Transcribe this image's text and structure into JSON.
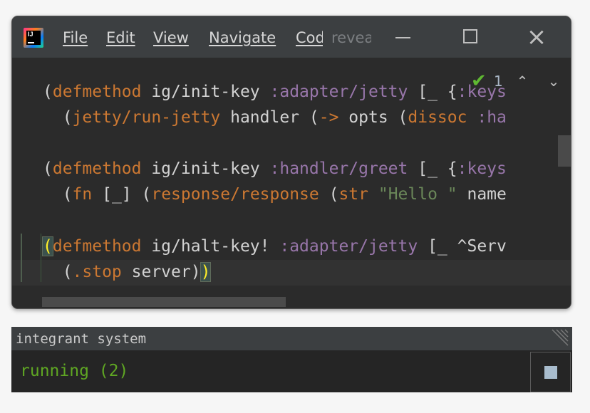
{
  "menu": {
    "file": "File",
    "edit": "Edit",
    "view": "View",
    "navigate": "Navigate",
    "code": "Code",
    "search_hint": "reveal"
  },
  "app_logo_text": "IJ",
  "window_controls": [
    "minimize-icon",
    "maximize-icon",
    "close-icon"
  ],
  "close_glyph": "×",
  "inspection": {
    "icon": "double-check-icon",
    "count": "1",
    "up": "⌃",
    "down": "⌄"
  },
  "code": {
    "line1": {
      "p1": "(",
      "kw": "defmethod",
      "p2": " ig/init-key ",
      "kwd": ":adapter/jetty",
      "p3": " [_ {",
      "kwd2": ":keys"
    },
    "line2": {
      "p1": "  (",
      "fn1": "jetty/run-jetty",
      "p2": " handler (",
      "arrow": "->",
      "p3": " opts (",
      "fn2": "dissoc",
      "p4": " ",
      "kwd": ":ha"
    },
    "line3": {
      "p1": "(",
      "kw": "defmethod",
      "p2": " ig/init-key ",
      "kwd": ":handler/greet",
      "p3": " [_ {",
      "kwd2": ":keys"
    },
    "line4": {
      "p1": "  (",
      "fn1": "fn",
      "p2": " [_] (",
      "fn2": "response/response",
      "p3": " (",
      "fn3": "str",
      "p4": " ",
      "str": "\"Hello \"",
      "p5": " name"
    },
    "line5": {
      "p1": "(",
      "kw": "defmethod",
      "p2": " ig/halt-key! ",
      "kwd": ":adapter/jetty",
      "p3": " [_ ^Serv"
    },
    "line6": {
      "p1": "  (",
      "fn1": ".stop",
      "p2": " server)",
      "p3": ")"
    }
  },
  "panel": {
    "title": "integrant system",
    "status": "running (2)",
    "stop_icon": "stop-icon"
  },
  "colors": {
    "background": "#2b2b2b",
    "keyword": "#cc7832",
    "keyword_symbol": "#9876aa",
    "string": "#6a8759",
    "status_green": "#5fa623"
  }
}
